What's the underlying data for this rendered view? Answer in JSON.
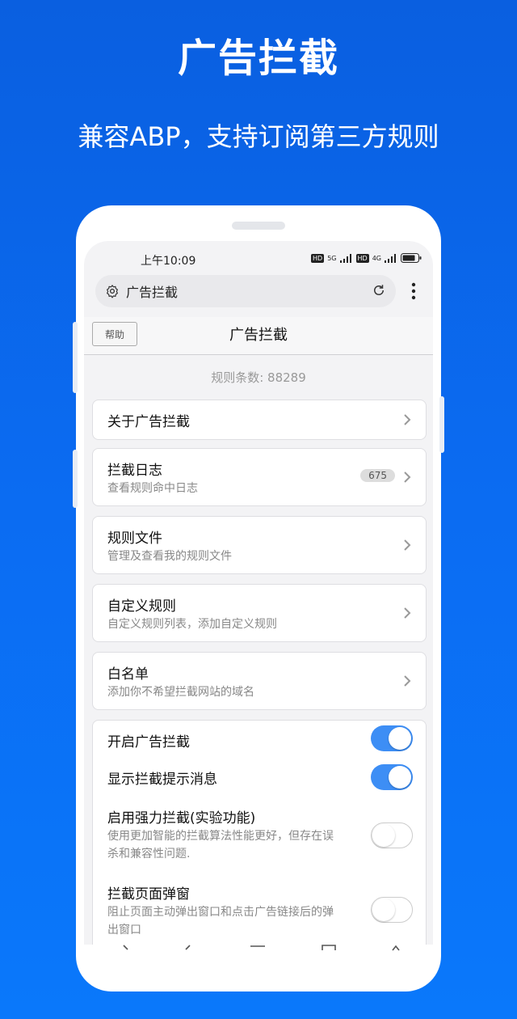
{
  "promo": {
    "title": "广告拦截",
    "subtitle": "兼容ABP，支持订阅第三方规则"
  },
  "status_bar": {
    "time": "上午10:09",
    "net1": "5G",
    "net2": "4G",
    "hd": "HD"
  },
  "url_bar": {
    "text": "广告拦截"
  },
  "header": {
    "help_label": "帮助",
    "title": "广告拦截"
  },
  "rule_count": "规则条数: 88289",
  "menu": [
    {
      "title": "关于广告拦截"
    },
    {
      "title": "拦截日志",
      "subtitle": "查看规则命中日志",
      "badge": "675"
    },
    {
      "title": "规则文件",
      "subtitle": "管理及查看我的规则文件"
    },
    {
      "title": "自定义规则",
      "subtitle": "自定义规则列表，添加自定义规则"
    },
    {
      "title": "白名单",
      "subtitle": "添加你不希望拦截网站的域名"
    }
  ],
  "settings": [
    {
      "title": "开启广告拦截",
      "enabled": true
    },
    {
      "title": "显示拦截提示消息",
      "enabled": true
    },
    {
      "title": "启用强力拦截(实验功能)",
      "desc_line1": "使用更加智能的拦截算法性能更好，但存在误",
      "desc_line2": "杀和兼容性问题.",
      "enabled": false
    },
    {
      "title": "拦截页面弹窗",
      "desc_line1": "阻止页面主动弹出窗口和点击广告链接后的弹",
      "desc_line2": "出窗口",
      "enabled": false
    }
  ],
  "colors": {
    "accent": "#3d8ef5",
    "background_top": "#0a5fe0",
    "background_bottom": "#0a78fb"
  }
}
